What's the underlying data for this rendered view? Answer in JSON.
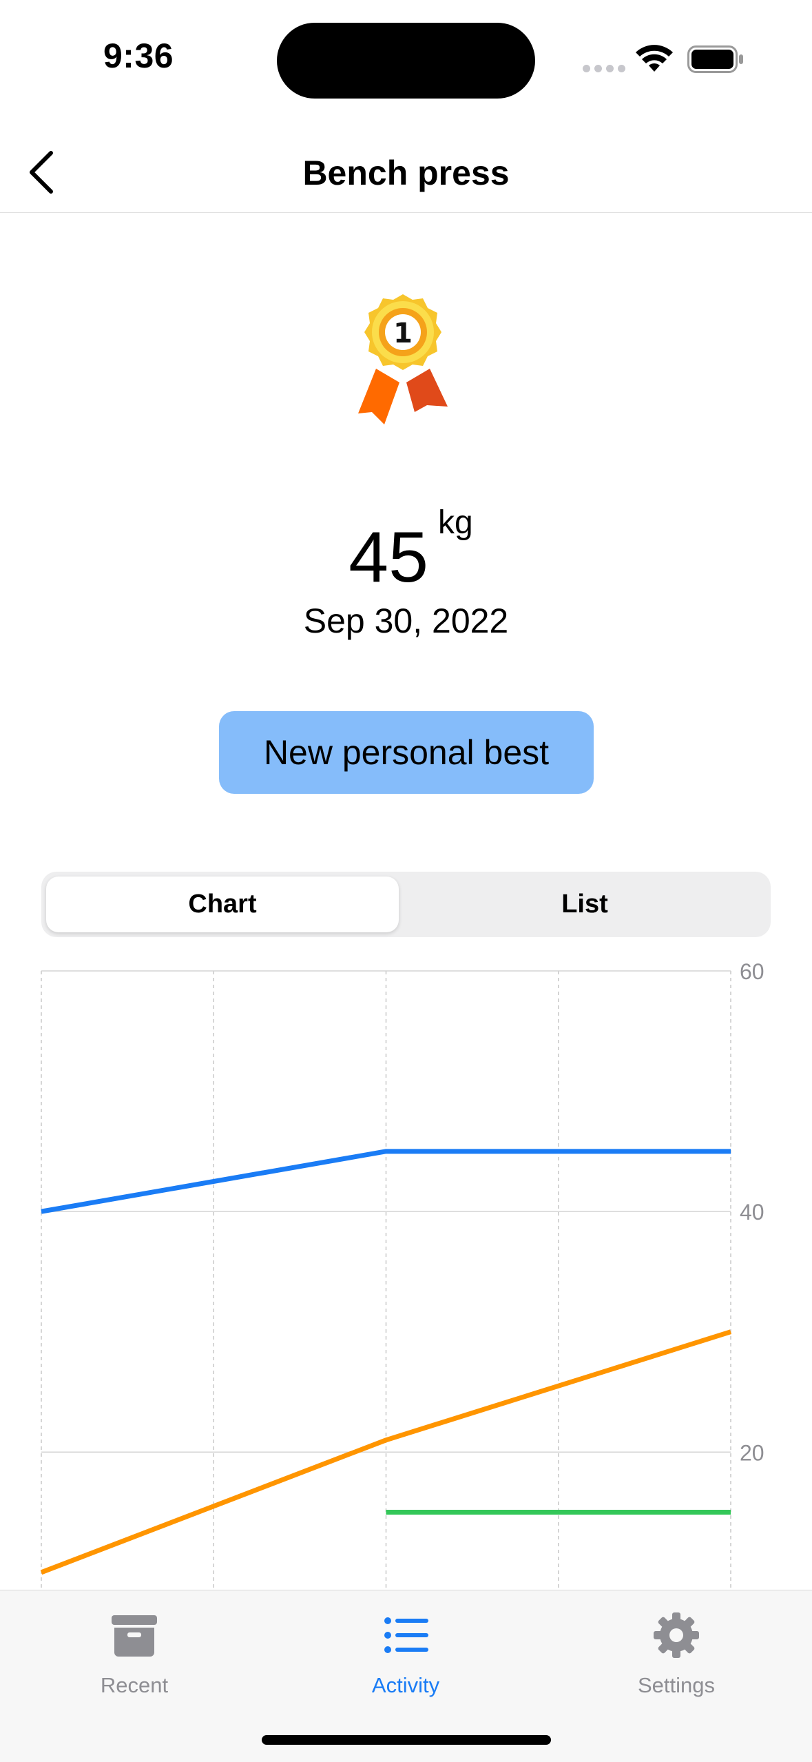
{
  "status_bar": {
    "time": "9:36"
  },
  "nav": {
    "title": "Bench press"
  },
  "hero": {
    "weight": "45",
    "unit": "kg",
    "date": "Sep 30, 2022",
    "badge_label": "New personal best"
  },
  "segmented": {
    "options": [
      "Chart",
      "List"
    ],
    "selected": "Chart"
  },
  "chart_data": {
    "type": "line",
    "title": "",
    "xlabel": "",
    "ylabel": "",
    "ylim": [
      8.5,
      60
    ],
    "y_ticks": [
      "60",
      "40",
      "20"
    ],
    "x": [
      0,
      1,
      2
    ],
    "series": [
      {
        "color": "#1a7cf5",
        "x": [
          0,
          1,
          2
        ],
        "values": [
          40,
          45,
          45
        ]
      },
      {
        "color": "#ff9500",
        "x": [
          0,
          1,
          2
        ],
        "values": [
          10,
          21,
          30
        ]
      },
      {
        "color": "#34c759",
        "x": [
          1,
          2
        ],
        "values": [
          15,
          15
        ]
      }
    ],
    "grid": true
  },
  "tabbar": {
    "tabs": [
      {
        "label": "Recent",
        "icon": "archive-box-icon",
        "active": false
      },
      {
        "label": "Activity",
        "icon": "list-bullet-icon",
        "active": true
      },
      {
        "label": "Settings",
        "icon": "gear-icon",
        "active": false
      }
    ],
    "active_color": "#1a7cf5",
    "inactive_color": "#8e8e93"
  }
}
